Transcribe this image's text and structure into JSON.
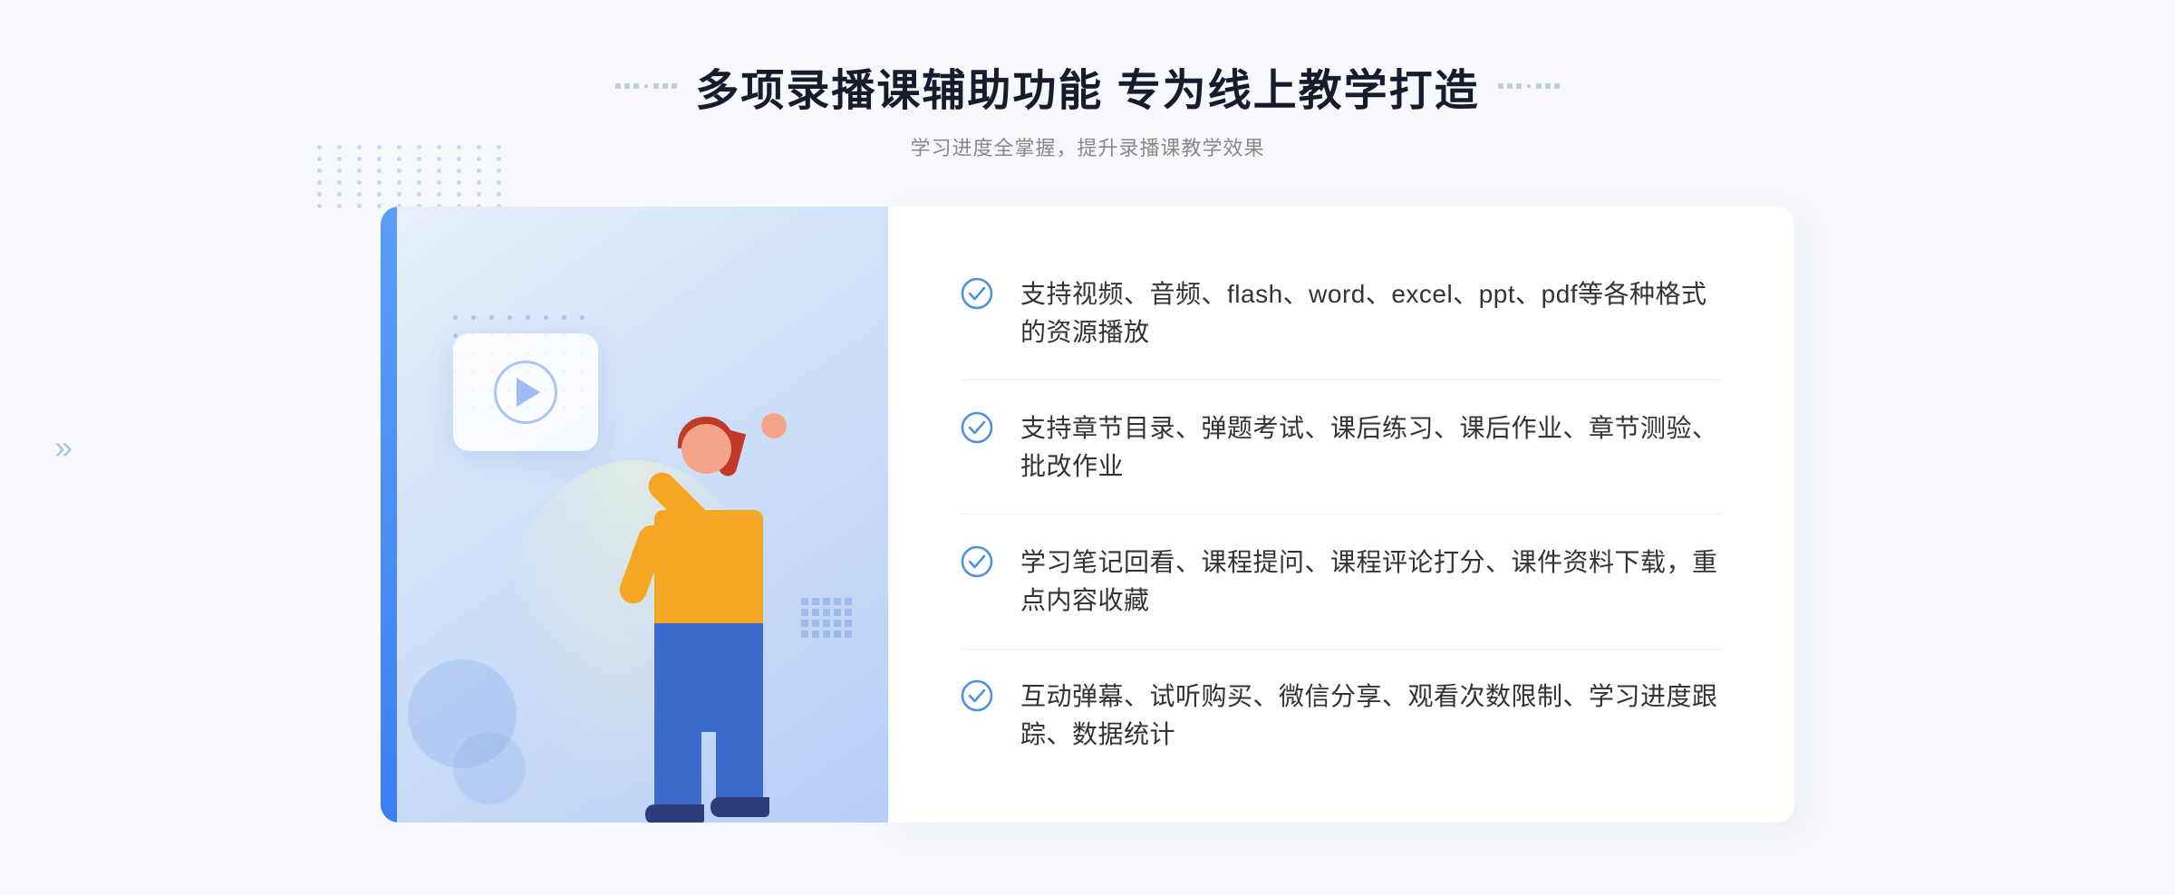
{
  "header": {
    "title": "多项录播课辅助功能 专为线上教学打造",
    "subtitle": "学习进度全掌握，提升录播课教学效果",
    "title_decorator_left": "···",
    "title_decorator_right": "···"
  },
  "features": [
    {
      "id": "feature-1",
      "text": "支持视频、音频、flash、word、excel、ppt、pdf等各种格式的资源播放"
    },
    {
      "id": "feature-2",
      "text": "支持章节目录、弹题考试、课后练习、课后作业、章节测验、批改作业"
    },
    {
      "id": "feature-3",
      "text": "学习笔记回看、课程提问、课程评论打分、课件资料下载，重点内容收藏"
    },
    {
      "id": "feature-4",
      "text": "互动弹幕、试听购买、微信分享、观看次数限制、学习进度跟踪、数据统计"
    }
  ],
  "colors": {
    "primary": "#4a90e2",
    "accent": "#3b7ff0",
    "check_color": "#4a90e2",
    "title_color": "#1a1a2e",
    "text_color": "#333333",
    "subtitle_color": "#888888"
  },
  "icons": {
    "check": "check-circle-icon",
    "play": "play-icon",
    "left_arrow": "left-arrow-icon"
  }
}
